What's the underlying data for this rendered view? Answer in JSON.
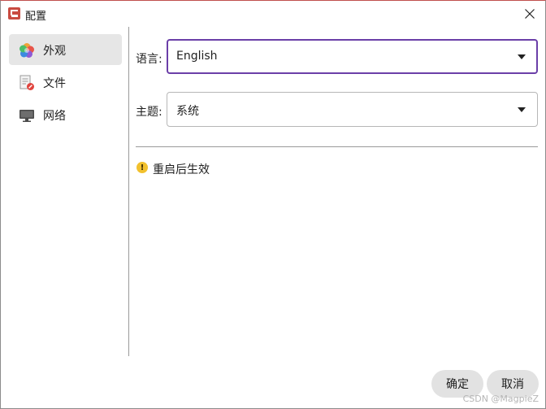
{
  "window": {
    "title": "配置",
    "accent_color": "#6b3fa8"
  },
  "sidebar": {
    "items": [
      {
        "label": "外观",
        "icon": "palette-icon",
        "active": true
      },
      {
        "label": "文件",
        "icon": "file-icon",
        "active": false
      },
      {
        "label": "网络",
        "icon": "monitor-icon",
        "active": false
      }
    ]
  },
  "form": {
    "language": {
      "label": "语言:",
      "value": "English"
    },
    "theme": {
      "label": "主题:",
      "value": "系统"
    }
  },
  "notice": {
    "icon": "warning-icon",
    "text": "重启后生效"
  },
  "buttons": {
    "ok": "确定",
    "cancel": "取消"
  },
  "watermark": "CSDN @MagpieZ"
}
